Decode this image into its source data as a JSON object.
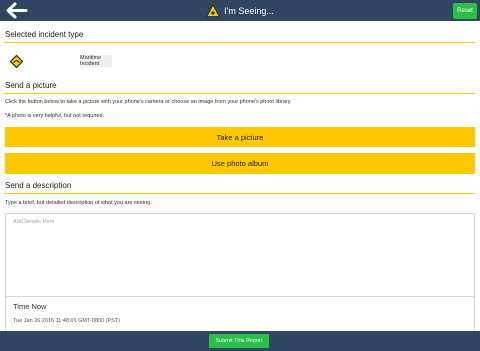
{
  "header": {
    "title": "I'm Seeing...",
    "title_icon": "warning-icon",
    "back_icon": "back-arrow-icon",
    "reset_label": "Reset"
  },
  "incident": {
    "section_title": "Selected incident type",
    "icon": "warning-diamond-icon",
    "type_label": "Maritime Incident"
  },
  "picture": {
    "section_title": "Send a picture",
    "instructions": "Click the button below to take a picture with your phone's camera or choose an image from your phone's photo library.",
    "note": "*A photo is very helpful, but not required.",
    "take_picture_label": "Take a picture",
    "photo_album_label": "Use photo album"
  },
  "description": {
    "section_title": "Send a description",
    "instructions": "Type a brief, but detailed description of what you are seeing.",
    "placeholder": "Add Details Here"
  },
  "time": {
    "label": "Time Now",
    "value": "Tue Jan 26 2016 11:48:01 GMT-0800 (PST)"
  },
  "footer": {
    "submit_label": "Submit This Report"
  },
  "colors": {
    "bar": "#2f4560",
    "accent_yellow": "#ffc800",
    "green": "#2bbf4a"
  }
}
